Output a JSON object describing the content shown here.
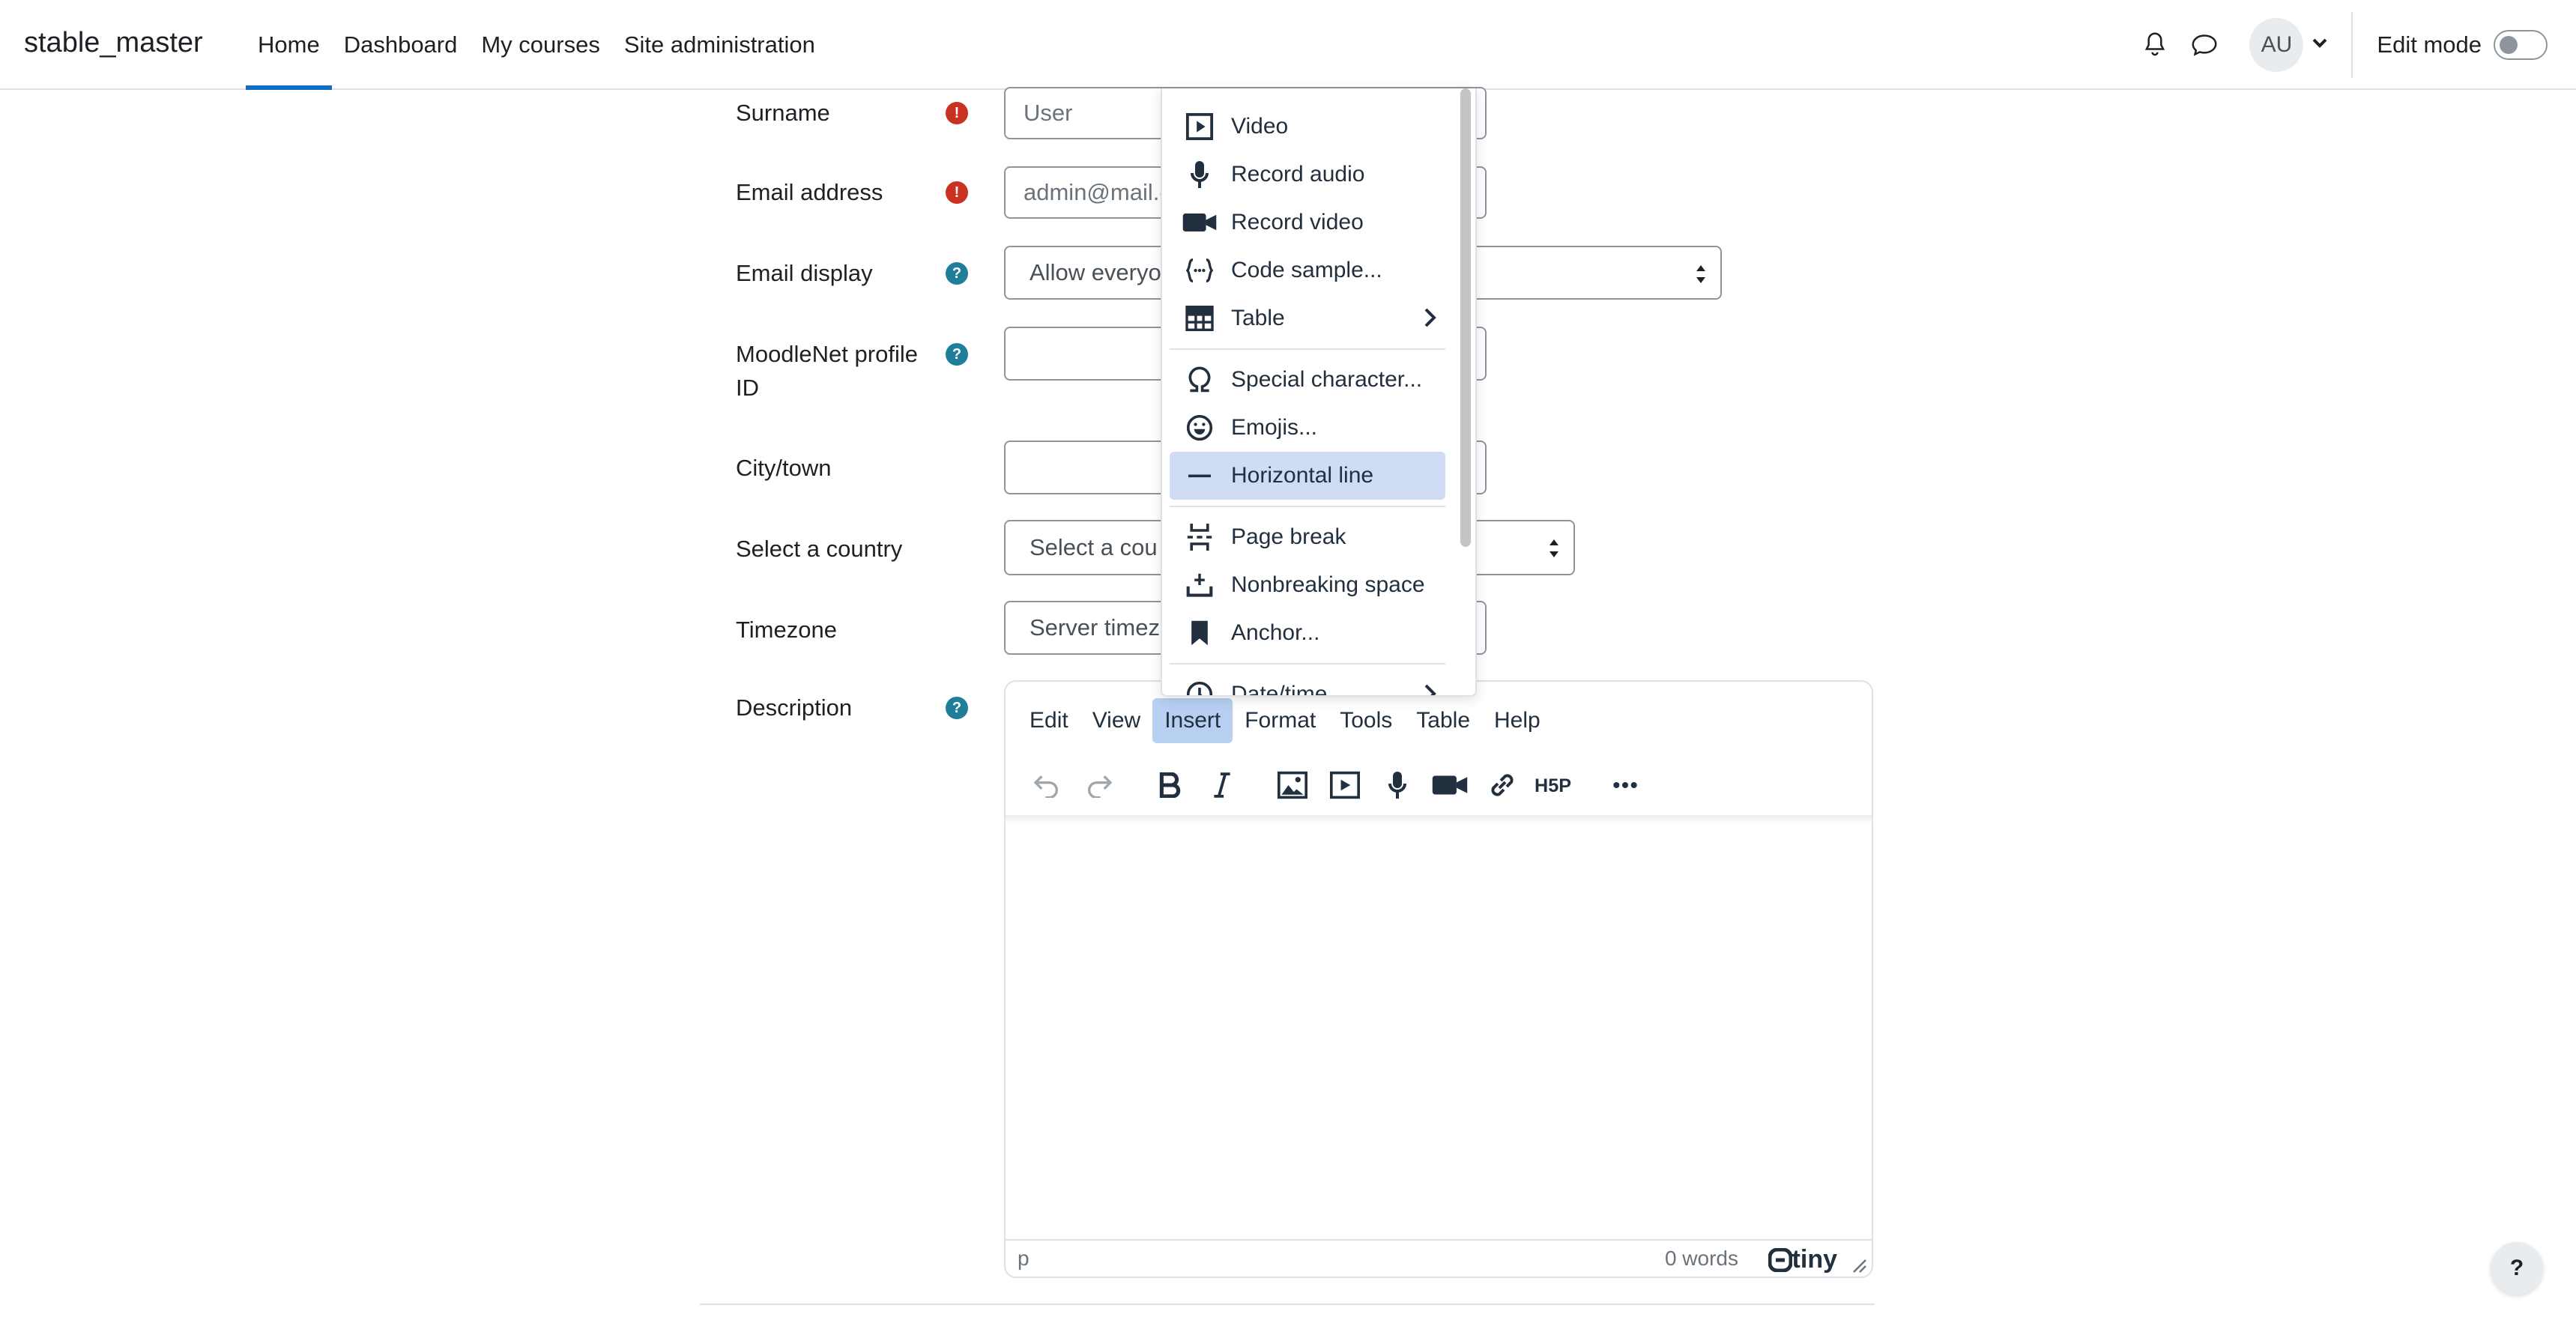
{
  "navbar": {
    "brand": "stable_master",
    "links": [
      {
        "label": "Home",
        "active": true
      },
      {
        "label": "Dashboard",
        "active": false
      },
      {
        "label": "My courses",
        "active": false
      },
      {
        "label": "Site administration",
        "active": false
      }
    ],
    "avatar_initials": "AU",
    "edit_mode_label": "Edit mode",
    "edit_mode_on": false
  },
  "form": {
    "surname": {
      "label": "Surname",
      "value": "User"
    },
    "email": {
      "label": "Email address",
      "value": "admin@mail.c"
    },
    "email_display": {
      "label": "Email display",
      "value": "Allow everyo"
    },
    "moodlenet": {
      "label": "MoodleNet profile ID",
      "value": ""
    },
    "city": {
      "label": "City/town",
      "value": ""
    },
    "country": {
      "label": "Select a country",
      "value": "Select a cou"
    },
    "timezone": {
      "label": "Timezone",
      "value": "Server timez"
    },
    "description": {
      "label": "Description"
    }
  },
  "editor": {
    "menus": [
      "Edit",
      "View",
      "Insert",
      "Format",
      "Tools",
      "Table",
      "Help"
    ],
    "active_menu": "Insert",
    "statusbar": {
      "path": "p",
      "word_count": "0 words",
      "brand": "tiny"
    }
  },
  "insert_menu": {
    "items": [
      {
        "label": "Video",
        "icon": "video-icon",
        "submenu": false
      },
      {
        "label": "Record audio",
        "icon": "microphone-icon",
        "submenu": false
      },
      {
        "label": "Record video",
        "icon": "camera-icon",
        "submenu": false
      },
      {
        "label": "Code sample...",
        "icon": "code-sample-icon",
        "submenu": false
      },
      {
        "label": "Table",
        "icon": "table-icon",
        "submenu": true
      },
      {
        "label": "Special character...",
        "icon": "omega-icon",
        "submenu": false
      },
      {
        "label": "Emojis...",
        "icon": "emoji-icon",
        "submenu": false
      },
      {
        "label": "Horizontal line",
        "icon": "horizontal-line-icon",
        "submenu": false,
        "highlighted": true
      },
      {
        "label": "Page break",
        "icon": "page-break-icon",
        "submenu": false
      },
      {
        "label": "Nonbreaking space",
        "icon": "nonbreaking-space-icon",
        "submenu": false
      },
      {
        "label": "Anchor...",
        "icon": "bookmark-icon",
        "submenu": false
      },
      {
        "label": "Date/time",
        "icon": "clock-icon",
        "submenu": true
      }
    ]
  },
  "help_button": "?",
  "colors": {
    "accent": "#0f6cbf",
    "required": "#ca3120",
    "help": "#1f7e9a",
    "menu_highlight": "#cfdcf3"
  }
}
